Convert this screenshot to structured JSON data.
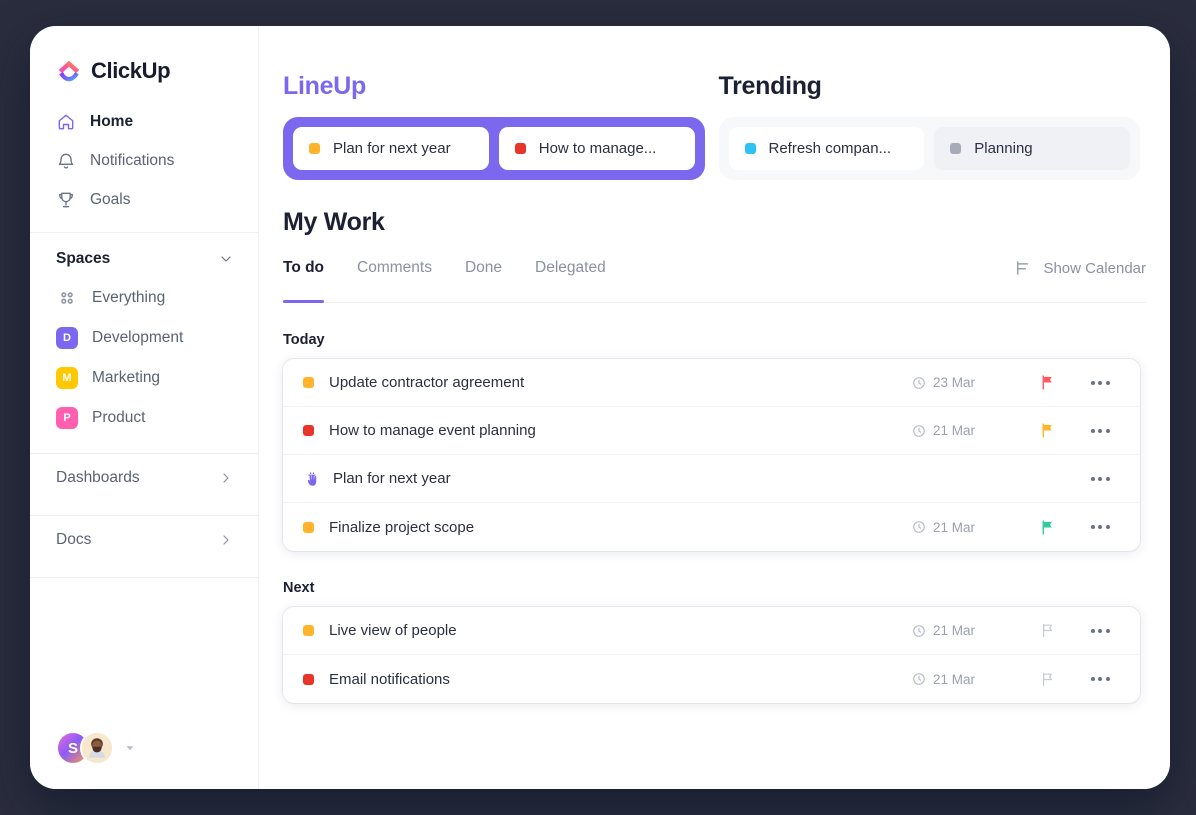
{
  "brand": {
    "name": "ClickUp",
    "accent": "#7b68ee"
  },
  "sidebar": {
    "nav": [
      {
        "label": "Home",
        "icon": "home-icon",
        "active": true
      },
      {
        "label": "Notifications",
        "icon": "bell-icon",
        "active": false
      },
      {
        "label": "Goals",
        "icon": "trophy-icon",
        "active": false
      }
    ],
    "spaces_header": "Spaces",
    "spaces": [
      {
        "label": "Everything",
        "badge": "",
        "color": "",
        "icon": "grid-dots-icon"
      },
      {
        "label": "Development",
        "badge": "D",
        "color": "#7b68ee"
      },
      {
        "label": "Marketing",
        "badge": "M",
        "color": "#ffc800"
      },
      {
        "label": "Product",
        "badge": "P",
        "color": "#ff5fae"
      }
    ],
    "footer_links": [
      {
        "label": "Dashboards"
      },
      {
        "label": "Docs"
      }
    ],
    "avatars": {
      "initial": "S"
    }
  },
  "lineup": {
    "title": "LineUp",
    "items": [
      {
        "label": "Plan for next year",
        "color": "#ffb42b"
      },
      {
        "label": "How to manage...",
        "color": "#e8352a"
      }
    ]
  },
  "trending": {
    "title": "Trending",
    "items": [
      {
        "label": "Refresh compan...",
        "color": "#2ec3f4",
        "muted": false
      },
      {
        "label": "Planning",
        "color": "#a5abba",
        "muted": true
      }
    ]
  },
  "mywork": {
    "title": "My Work",
    "tabs": [
      {
        "label": "To do",
        "active": true
      },
      {
        "label": "Comments",
        "active": false
      },
      {
        "label": "Done",
        "active": false
      },
      {
        "label": "Delegated",
        "active": false
      }
    ],
    "calendar_toggle": {
      "label": "Show Calendar",
      "icon": "calendar-toggle-icon"
    },
    "groups": [
      {
        "title": "Today",
        "tasks": [
          {
            "name": "Update contractor agreement",
            "color": "#ffb42b",
            "marker": "square",
            "due": "23 Mar",
            "flag": "#ff5a5f",
            "flag_filled": true
          },
          {
            "name": "How to manage event planning",
            "color": "#e8352a",
            "marker": "square",
            "due": "21 Mar",
            "flag": "#ffb42b",
            "flag_filled": true
          },
          {
            "name": "Plan for next year",
            "color": "#7b68ee",
            "marker": "hand",
            "due": "",
            "flag": "",
            "flag_filled": false
          },
          {
            "name": "Finalize project scope",
            "color": "#ffb42b",
            "marker": "square",
            "due": "21 Mar",
            "flag": "#2ecc9b",
            "flag_filled": true
          }
        ]
      },
      {
        "title": "Next",
        "tasks": [
          {
            "name": "Live view of people",
            "color": "#ffb42b",
            "marker": "square",
            "due": "21 Mar",
            "flag": "#c8ccd6",
            "flag_filled": false
          },
          {
            "name": "Email notifications",
            "color": "#e8352a",
            "marker": "square",
            "due": "21 Mar",
            "flag": "#c8ccd6",
            "flag_filled": false
          }
        ]
      }
    ]
  }
}
